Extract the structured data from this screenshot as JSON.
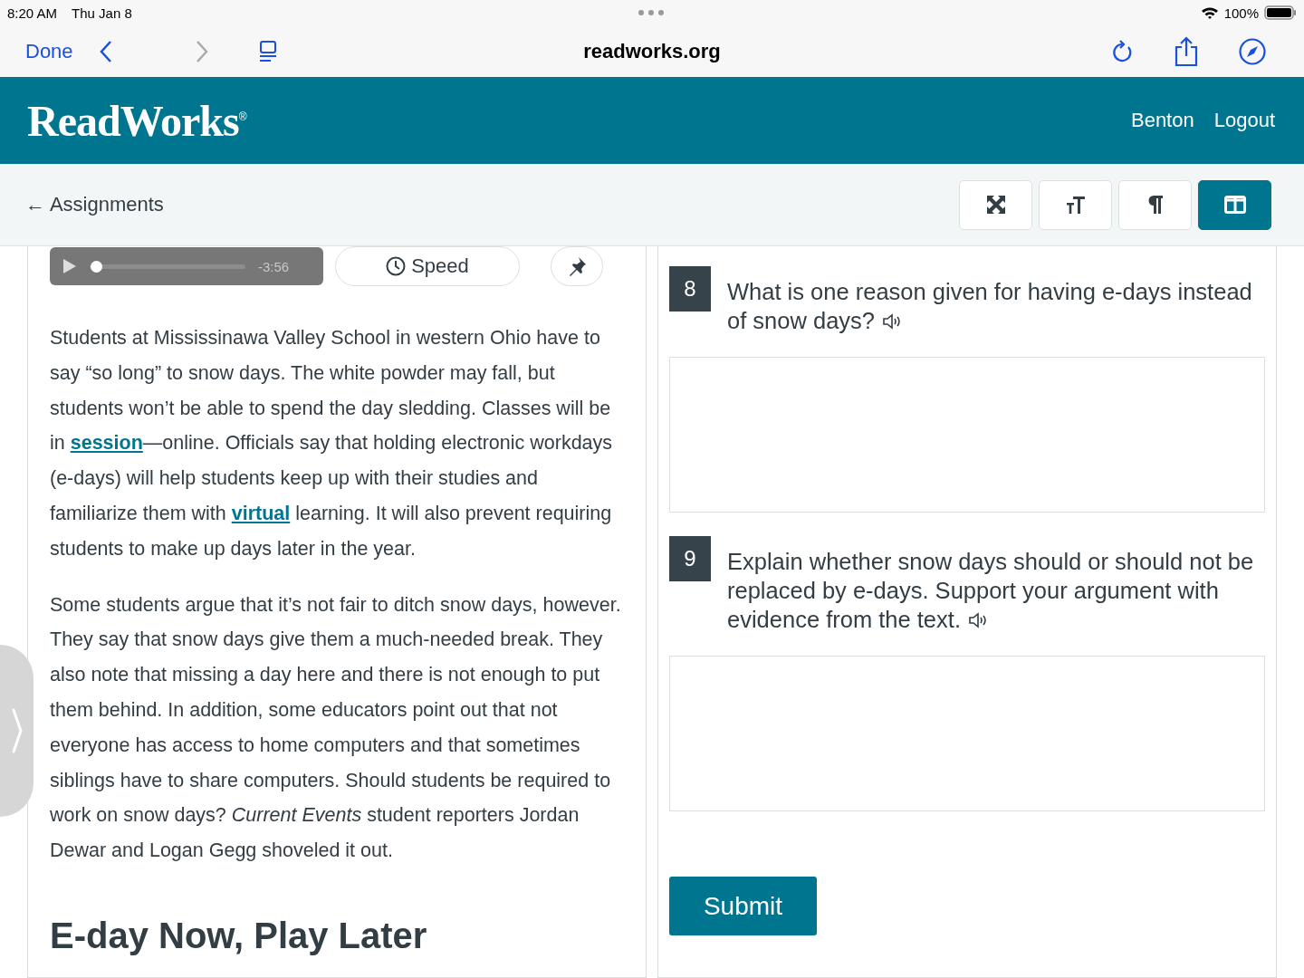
{
  "status_bar": {
    "time": "8:20 AM",
    "date": "Thu Jan 8",
    "battery": "100%"
  },
  "browser": {
    "done": "Done",
    "url": "readworks.org"
  },
  "header": {
    "logo": "ReadWorks",
    "logo_mark": "®",
    "user": "Benton",
    "logout": "Logout"
  },
  "subbar": {
    "back": "← Assignments",
    "tools": [
      {
        "kind": "expand",
        "selected": false
      },
      {
        "kind": "text-size",
        "selected": false
      },
      {
        "kind": "paragraph",
        "selected": false
      },
      {
        "kind": "columns",
        "selected": true
      }
    ]
  },
  "player": {
    "level": 0.04,
    "time": "-3:56",
    "speed": "Speed"
  },
  "article": {
    "paragraphs": [
      [
        {
          "kind": "text",
          "text": "Students at Mississinawa Valley School in western Ohio have to say “so long” to snow days. The white powder may fall, but students won’t be able to spend the day sledding. Classes will be in "
        },
        {
          "kind": "link",
          "text": "session"
        },
        {
          "kind": "text",
          "text": "—online. Officials say that holding electronic workdays (e-days) will help students keep up with their studies and familiarize them with "
        },
        {
          "kind": "link",
          "text": "virtual"
        },
        {
          "kind": "text",
          "text": " learning. It will also prevent requiring students to make up days later in the year."
        }
      ],
      [
        {
          "kind": "text",
          "text": "Some students argue that it’s not fair to ditch snow days, however. They say that snow days give them a much-needed break. They also note that missing a day here and there is not enough to put them behind. In addition, some educators point out that not everyone has access to home computers and that sometimes siblings have to share computers. Should students be required to work on snow days? *Current Events* student reporters Jordan Dewar and Logan Gegg shoveled it out."
        }
      ]
    ],
    "heading": "E-day Now, Play Later"
  },
  "questions": [
    {
      "number": "8",
      "text": "What is one reason given for having e-days instead of snow days?"
    },
    {
      "number": "9",
      "text": "Explain whether snow days should or should not be replaced by e-days. Support your argument with evidence from the text."
    }
  ],
  "submit": "Submit"
}
